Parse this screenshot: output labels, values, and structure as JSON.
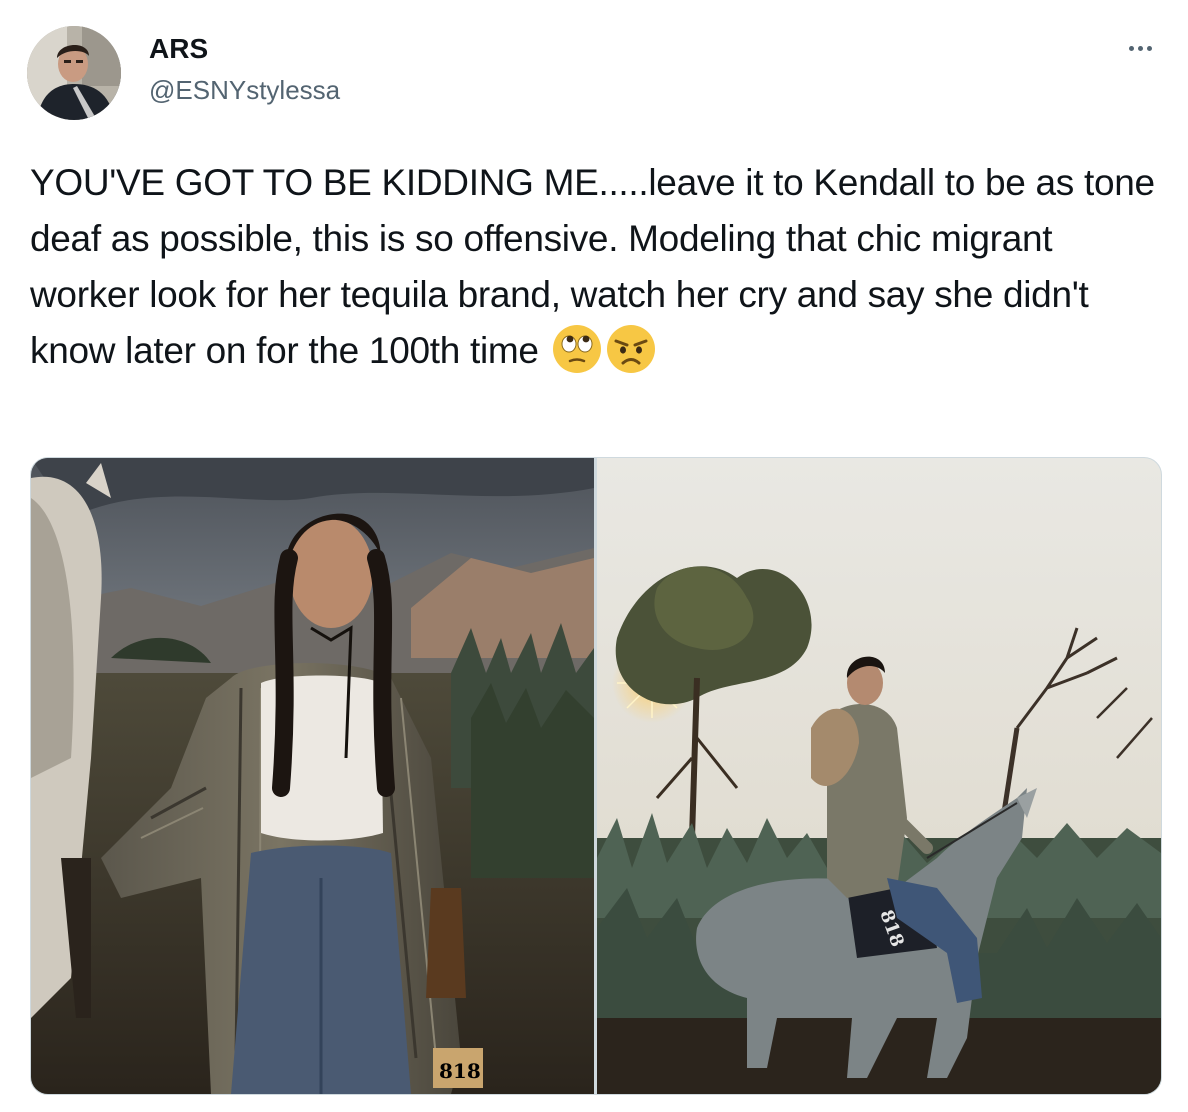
{
  "author": {
    "display_name": "ARS",
    "handle": "@ESNYstylessa"
  },
  "tweet": {
    "text": "YOU'VE GOT TO BE KIDDING ME.....leave it to Kendall to be as tone deaf as possible, this is so offensive. Modeling that chic migrant worker look for her tequila brand, watch her cry and say she didn't know later on for the 100th time",
    "emojis": [
      "face-with-rolling-eyes",
      "angry-face"
    ]
  },
  "media": {
    "photos": [
      {
        "bottle_label": "818"
      },
      {
        "saddle_label": "818"
      }
    ]
  },
  "icons": {
    "more": "more-horizontal-icon"
  },
  "colors": {
    "text_primary": "#0f1419",
    "text_secondary": "#536471",
    "border": "#cfd9de"
  }
}
